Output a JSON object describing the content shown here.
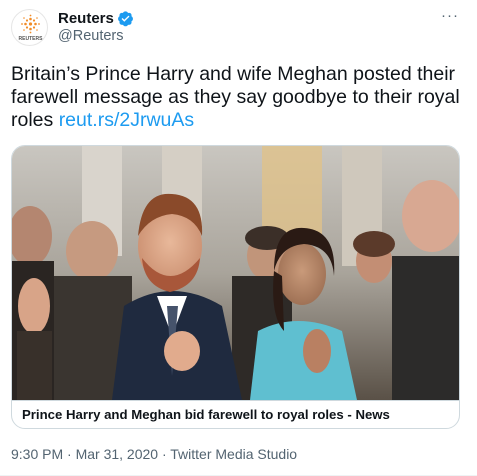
{
  "account": {
    "display_name": "Reuters",
    "handle": "@Reuters",
    "logo_text": "REUTERS",
    "verified_icon": "verified-badge-icon"
  },
  "tweet": {
    "text": "Britain’s Prince Harry and wife Meghan posted their farewell message as they say goodbye to their royal roles ",
    "link_text": "reut.rs/2JrwuAs"
  },
  "card": {
    "title": "Prince Harry and Meghan bid farewell to royal roles - News"
  },
  "meta": {
    "timestamp": "9:30 PM · Mar 31, 2020 · Twitter Media Studio"
  },
  "menu": {
    "more_icon": "more-options-icon",
    "more_label": "···"
  },
  "colors": {
    "accent": "#1d9bf0",
    "text": "#0f1419",
    "secondary": "#536471",
    "reuters_orange": "#f28c28"
  }
}
